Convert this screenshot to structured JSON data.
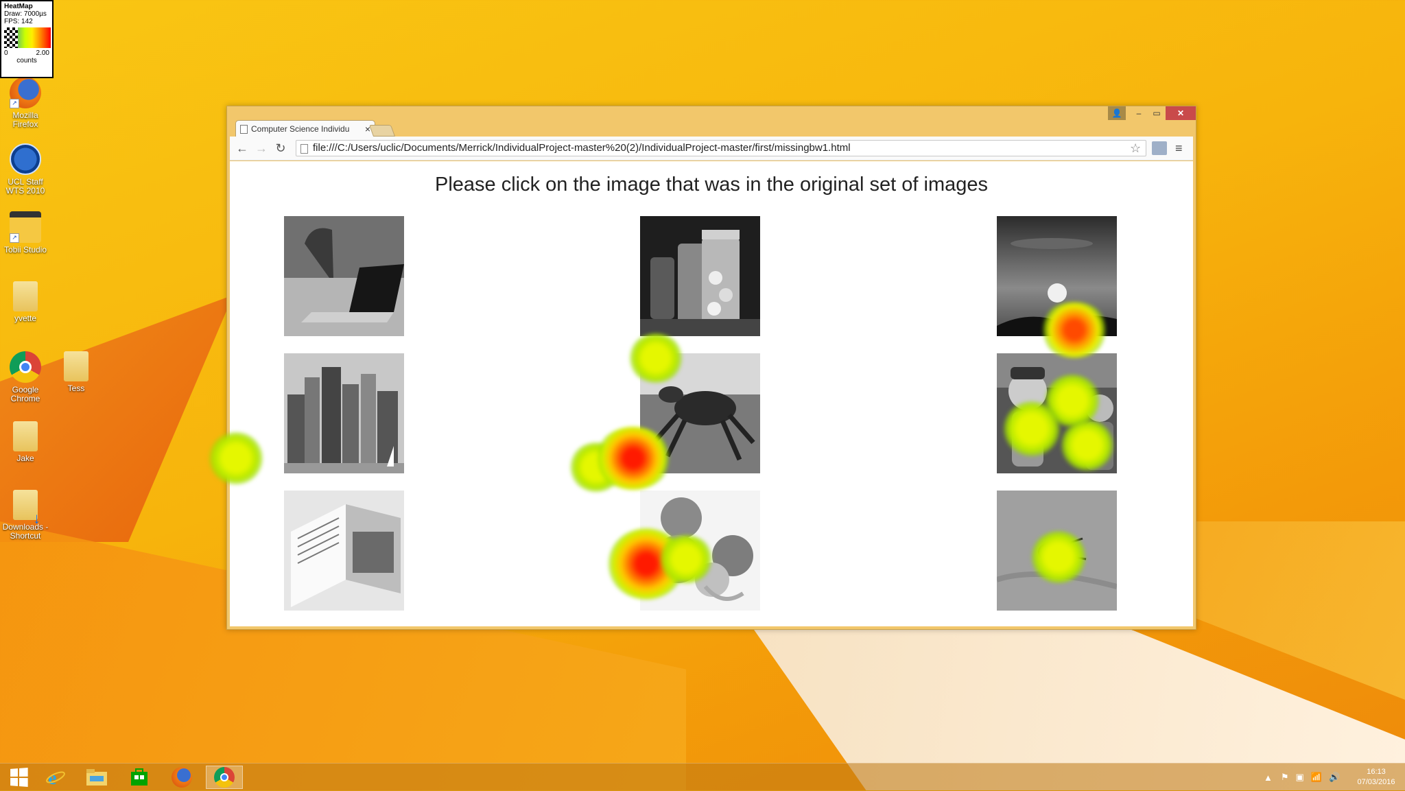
{
  "heatmap_legend": {
    "title": "HeatMap",
    "draw": "Draw: 7000µs",
    "fps": "FPS: 142",
    "min": "0",
    "max": "2.00",
    "units": "counts"
  },
  "desktop": {
    "icons": [
      {
        "label": "Mozilla Firefox",
        "icon": "firefox-icon"
      },
      {
        "label": "UCL Staff WTS 2010",
        "icon": "ucl-wts-icon"
      },
      {
        "label": "Tobii Studio",
        "icon": "tobii-studio-icon"
      },
      {
        "label": "yvette",
        "icon": "folder-icon"
      },
      {
        "label": "Google Chrome",
        "icon": "chrome-icon"
      },
      {
        "label": "Tess",
        "icon": "folder-icon"
      },
      {
        "label": "Jake",
        "icon": "folder-icon"
      },
      {
        "label": "Downloads - Shortcut",
        "icon": "downloads-shortcut-icon"
      }
    ]
  },
  "browser": {
    "tab_title": "Computer Science Individu",
    "url": "file:///C:/Users/uclic/Documents/Merrick/IndividualProject-master%20(2)/IndividualProject-master/first/missingbw1.html",
    "window_controls": {
      "user": "👤",
      "minimize": "–",
      "maximize": "▭",
      "close": "✕"
    },
    "nav": {
      "back": "←",
      "forward": "→",
      "reload": "↻",
      "star": "☆",
      "menu": "≡"
    }
  },
  "page": {
    "heading": "Please click on the image that was in the original set of images",
    "images": [
      {
        "subject": "laptop on grass"
      },
      {
        "subject": "glass jars"
      },
      {
        "subject": "sunset sky"
      },
      {
        "subject": "city skyline"
      },
      {
        "subject": "crab"
      },
      {
        "subject": "clown figurines"
      },
      {
        "subject": "open book"
      },
      {
        "subject": "oranges"
      },
      {
        "subject": "beetle on sand"
      }
    ]
  },
  "taskbar": {
    "items": [
      {
        "name": "start",
        "icon": "windows-logo-icon"
      },
      {
        "name": "internet-explorer",
        "icon": "internet-explorer-icon"
      },
      {
        "name": "file-explorer",
        "icon": "file-explorer-icon"
      },
      {
        "name": "store",
        "icon": "store-icon"
      },
      {
        "name": "firefox",
        "icon": "firefox-icon"
      },
      {
        "name": "chrome",
        "icon": "chrome-icon",
        "active": true
      }
    ],
    "tray_icons": [
      "▲",
      "⚑",
      "▣",
      "📶",
      "🔊"
    ],
    "time": "16:13",
    "date": "07/03/2016"
  },
  "colors": {
    "wallpaper": "#f7b40c",
    "window_frame": "#f2c76b",
    "close_button": "#c94a4a"
  }
}
